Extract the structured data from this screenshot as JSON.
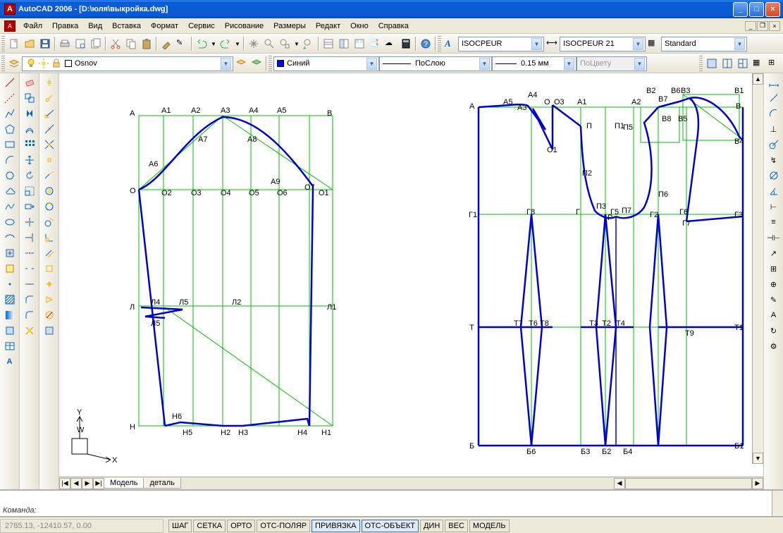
{
  "title": "AutoCAD 2006 - [D:\\юля\\выкройка.dwg]",
  "app_icon_letter": "A",
  "menu": [
    "Файл",
    "Правка",
    "Вид",
    "Вставка",
    "Формат",
    "Сервис",
    "Рисование",
    "Размеры",
    "Редакт",
    "Окно",
    "Справка"
  ],
  "style_combo1": "ISOCPEUR",
  "style_combo2": "ISOCPEUR 21",
  "style_combo3": "Standard",
  "layer_combo": "Osnov",
  "color_combo": "Синий",
  "ltype_combo": "ПоСлою",
  "lweight_combo": "0.15 мм",
  "plotstyle_combo": "ПоЦвету",
  "tabs": {
    "nav": [
      "|◀",
      "◀",
      "▶",
      "▶|"
    ],
    "items": [
      "Модель",
      "деталь"
    ],
    "active": 0
  },
  "command_prompt": "Команда:",
  "status_coord": "2785.13, -12410.57, 0.00",
  "status_toggles": [
    {
      "label": "ШАГ",
      "on": false
    },
    {
      "label": "СЕТКА",
      "on": false
    },
    {
      "label": "ОРТО",
      "on": false
    },
    {
      "label": "ОТС-ПОЛЯР",
      "on": false
    },
    {
      "label": "ПРИВЯЗКА",
      "on": true
    },
    {
      "label": "ОТС-ОБЪЕКТ",
      "on": true
    },
    {
      "label": "ДИН",
      "on": false
    },
    {
      "label": "ВЕС",
      "on": false
    },
    {
      "label": "МОДЕЛЬ",
      "on": false
    }
  ],
  "drawing_labels_left": {
    "top": [
      "А",
      "А1",
      "А2",
      "А3",
      "А4",
      "А5",
      "В"
    ],
    "row2": [
      "А7",
      "А8"
    ],
    "row3": [
      "А6",
      "А9"
    ],
    "O": [
      "О",
      "О2",
      "О3",
      "О4",
      "О5",
      "О6",
      "О7",
      "О1"
    ],
    "L": [
      "Л",
      "Л4",
      "Л5",
      "Л2",
      "Л1"
    ],
    "L5b": "Л5",
    "H": [
      "Н",
      "Н6",
      "Н5",
      "Н2",
      "Н3",
      "Н4",
      "Н1"
    ]
  },
  "drawing_labels_right": {
    "top": [
      "А",
      "А5",
      "А3",
      "А4",
      "О",
      "О3",
      "А1",
      "А2",
      "В2",
      "В7",
      "В6",
      "В3",
      "В1",
      "В"
    ],
    "row2": [
      "О1",
      "П",
      "П1",
      "П5",
      "В8",
      "В5",
      "В4"
    ],
    "row3": [
      "П2",
      "П6"
    ],
    "G": [
      "Г1",
      "Г8",
      "Г",
      "П3",
      "Р",
      "Г5",
      "П7",
      "Г2",
      "Г6",
      "Г7",
      "Г3"
    ],
    "T": [
      "Т",
      "Т7",
      "Т6",
      "Т8",
      "Т3",
      "Т2",
      "Т4",
      "Т9",
      "Т1"
    ],
    "B": [
      "Б",
      "Б6",
      "Б3",
      "Б2",
      "Б4",
      "Б1"
    ]
  }
}
